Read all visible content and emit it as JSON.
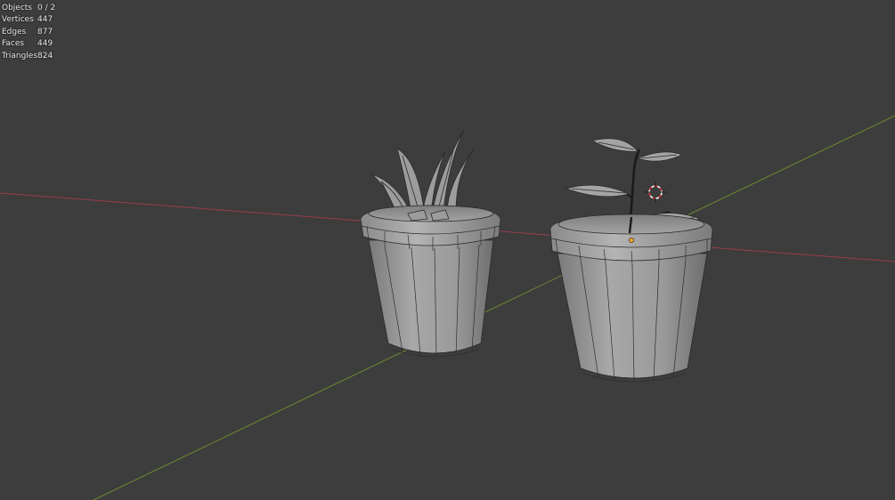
{
  "viewport": {
    "background": "#3d3d3d",
    "x_axis_color": "#9a3d4a",
    "y_axis_color": "#6b8a2e",
    "mesh_color": "#9e9e9e",
    "wire_color": "#2a2a2a"
  },
  "stats": [
    {
      "label": "Objects",
      "value": "0 / 2"
    },
    {
      "label": "Vertices",
      "value": "447"
    },
    {
      "label": "Edges",
      "value": "877"
    },
    {
      "label": "Faces",
      "value": "449"
    },
    {
      "label": "Triangles",
      "value": "824"
    }
  ],
  "objects": [
    {
      "name": "pot-with-aloe"
    },
    {
      "name": "pot-with-sapling"
    }
  ],
  "cursor": {
    "icon": "3d-cursor-icon"
  },
  "origin": {
    "icon": "object-origin-icon",
    "color": "#f5a623"
  }
}
